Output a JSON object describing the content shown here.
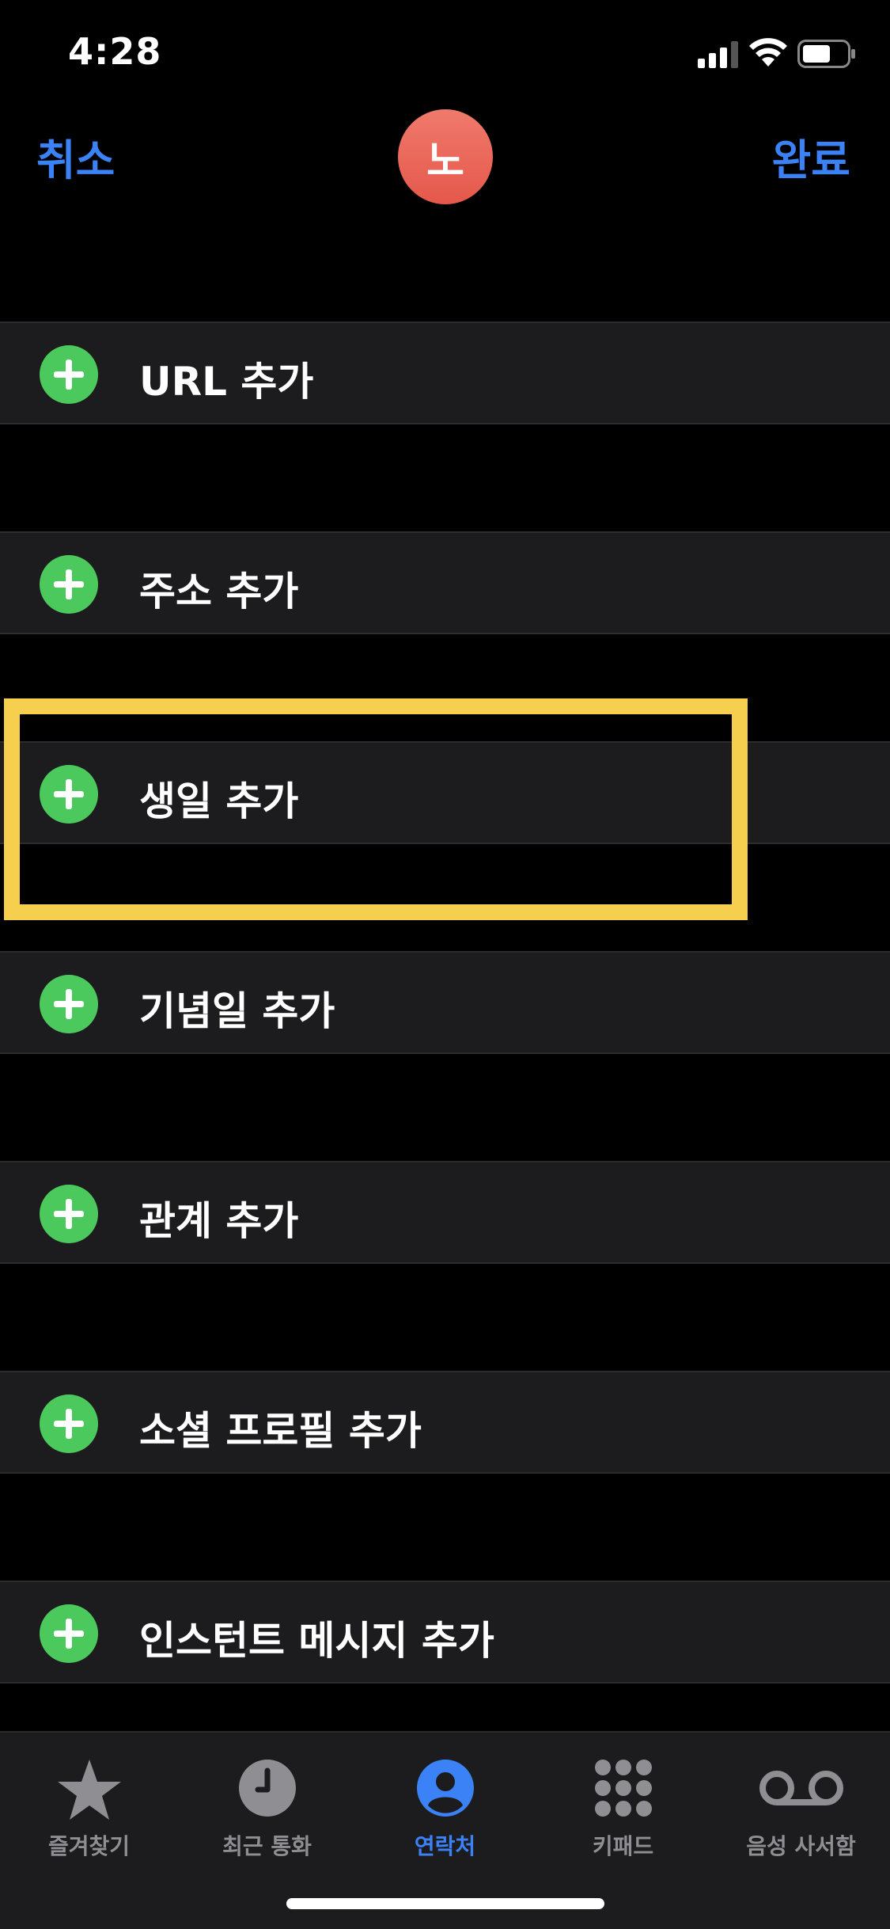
{
  "status_bar": {
    "time": "4:28"
  },
  "nav": {
    "cancel_label": "취소",
    "done_label": "완료",
    "avatar_initial": "노"
  },
  "rows": [
    {
      "label": "URL 추가"
    },
    {
      "label": "주소 추가"
    },
    {
      "label": "생일 추가"
    },
    {
      "label": "기념일 추가"
    },
    {
      "label": "관계 추가"
    },
    {
      "label": "소셜 프로필 추가"
    },
    {
      "label": "인스턴트 메시지 추가"
    }
  ],
  "tabs": [
    {
      "label": "즐겨찾기",
      "icon": "star-icon",
      "active": false
    },
    {
      "label": "최근 통화",
      "icon": "clock-icon",
      "active": false
    },
    {
      "label": "연락처",
      "icon": "person-circle-icon",
      "active": true
    },
    {
      "label": "키패드",
      "icon": "keypad-icon",
      "active": false
    },
    {
      "label": "음성 사서함",
      "icon": "voicemail-icon",
      "active": false
    }
  ],
  "colors": {
    "accent": "#3b82f6",
    "add_button": "#4cc95c",
    "avatar": "#e86a5d",
    "highlight": "#f6cf4f",
    "row_background": "#1c1c1e"
  }
}
